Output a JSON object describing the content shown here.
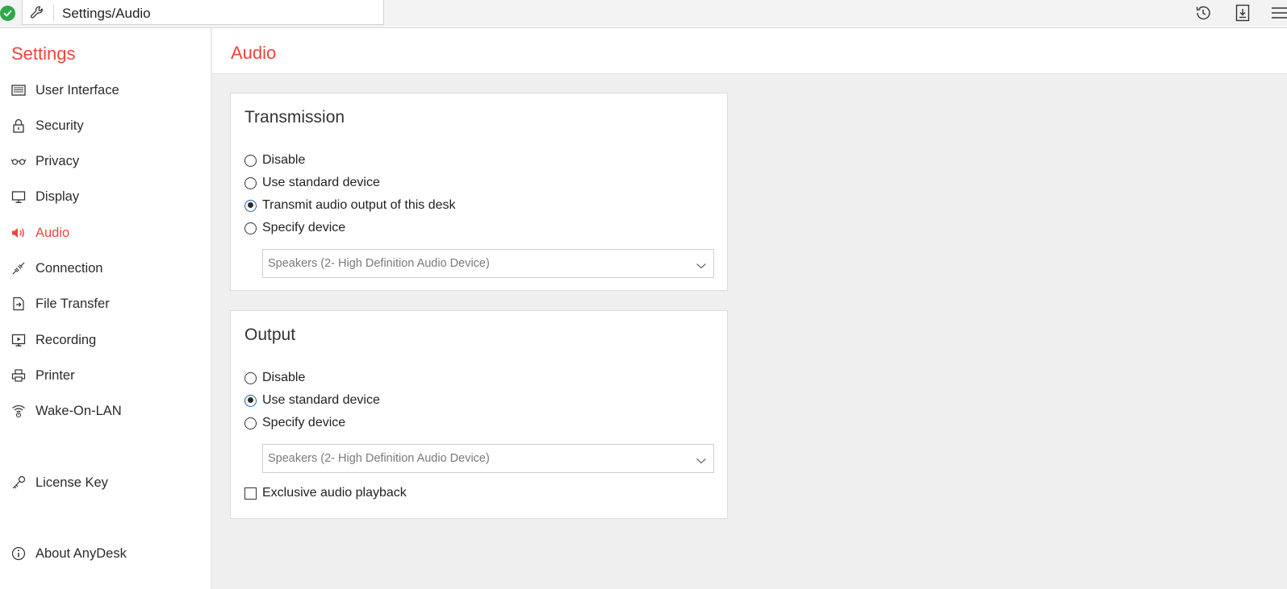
{
  "address_bar": {
    "path": "Settings/Audio"
  },
  "sidebar": {
    "title": "Settings",
    "items": [
      {
        "label": "User Interface",
        "icon": "user-interface-icon"
      },
      {
        "label": "Security",
        "icon": "lock-icon"
      },
      {
        "label": "Privacy",
        "icon": "glasses-icon"
      },
      {
        "label": "Display",
        "icon": "monitor-icon"
      },
      {
        "label": "Audio",
        "icon": "speaker-icon",
        "active": true
      },
      {
        "label": "Connection",
        "icon": "connection-icon"
      },
      {
        "label": "File Transfer",
        "icon": "file-transfer-icon"
      },
      {
        "label": "Recording",
        "icon": "recording-icon"
      },
      {
        "label": "Printer",
        "icon": "printer-icon"
      },
      {
        "label": "Wake-On-LAN",
        "icon": "wifi-icon"
      },
      {
        "label": "License Key",
        "icon": "key-icon"
      },
      {
        "label": "About AnyDesk",
        "icon": "info-icon"
      }
    ]
  },
  "main": {
    "title": "Audio",
    "transmission": {
      "title": "Transmission",
      "options": [
        "Disable",
        "Use standard device",
        "Transmit audio output of this desk",
        "Specify device"
      ],
      "selected_index": 2,
      "device": "Speakers (2- High Definition Audio Device)"
    },
    "output": {
      "title": "Output",
      "options": [
        "Disable",
        "Use standard device",
        "Specify device"
      ],
      "selected_index": 1,
      "device": "Speakers (2- High Definition Audio Device)",
      "exclusive_label": "Exclusive audio playback",
      "exclusive_checked": false
    }
  },
  "colors": {
    "accent": "#ef443b",
    "status_ok": "#2ea84a"
  }
}
